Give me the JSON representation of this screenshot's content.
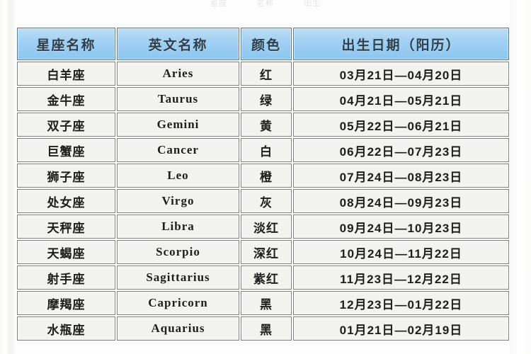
{
  "page": {
    "top_faint_fragments": [
      "星座",
      "名称",
      "出生"
    ]
  },
  "table": {
    "columns": [
      {
        "key": "name",
        "label": "星座名称"
      },
      {
        "key": "en",
        "label": "英文名称"
      },
      {
        "key": "color",
        "label": "颜色"
      },
      {
        "key": "date",
        "label": "出生日期（阳历）"
      }
    ],
    "header_bg": "#8cc6f0",
    "row_bg": "#f2f2ee",
    "border_color": "#7c807c",
    "rows": [
      {
        "name": "白羊座",
        "en": "Aries",
        "color": "红",
        "date": "03月21日—04月20日"
      },
      {
        "name": "金牛座",
        "en": "Taurus",
        "color": "绿",
        "date": "04月21日—05月21日"
      },
      {
        "name": "双子座",
        "en": "Gemini",
        "color": "黄",
        "date": "05月22日—06月21日"
      },
      {
        "name": "巨蟹座",
        "en": "Cancer",
        "color": "白",
        "date": "06月22日—07月23日"
      },
      {
        "name": "狮子座",
        "en": "Leo",
        "color": "橙",
        "date": "07月24日—08月23日"
      },
      {
        "name": "处女座",
        "en": "Virgo",
        "color": "灰",
        "date": "08月24日—09月23日"
      },
      {
        "name": "天秤座",
        "en": "Libra",
        "color": "淡红",
        "date": "09月24日—10月23日"
      },
      {
        "name": "天蝎座",
        "en": "Scorpio",
        "color": "深红",
        "date": "10月24日—11月22日"
      },
      {
        "name": "射手座",
        "en": "Sagittarius",
        "color": "紫红",
        "date": "11月23日—12月22日"
      },
      {
        "name": "摩羯座",
        "en": "Capricorn",
        "color": "黑",
        "date": "12月23日—01月22日"
      },
      {
        "name": "水瓶座",
        "en": "Aquarius",
        "color": "黑",
        "date": "01月21日—02月19日"
      }
    ]
  }
}
